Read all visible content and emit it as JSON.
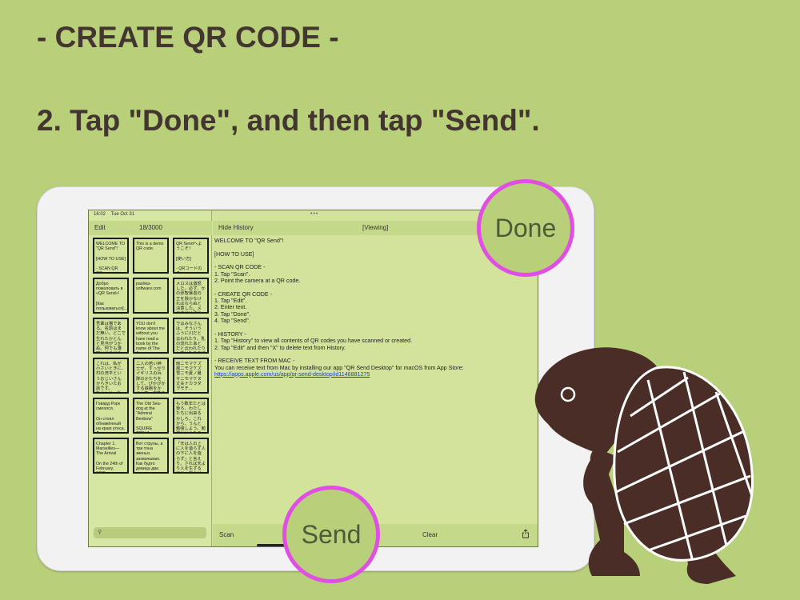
{
  "headings": {
    "title": "- CREATE QR CODE -",
    "instruction": "2. Tap \"Done\", and then tap \"Send\"."
  },
  "status": {
    "time": "16:02",
    "date": "Tue Oct 31"
  },
  "sidebar": {
    "edit_label": "Edit",
    "count": "18/3000",
    "search_placeholder": "",
    "cells": [
      "WELCOME TO \"QR Send\"!\n\n[HOW TO USE]\n\n- SCAN QR CO...",
      "This is a demo QR code.",
      "QR Sendへようこそ！\n\n[使い方]\n\n- QRコードのス...",
      "Добро пожаловать в «QR Send»!\n\n[Как пользоваться]...",
      "pashka-software.com",
      "メロスは激怒した。必ず、かの邪智暴虐の王を除かなければならぬと決意した。メロスには政治がわか...",
      "吾輩は猫である。名前はまだ無い。どこで生れたかとんと見当がつかぬ。何でも薄暗いじめじめした所...",
      "YOU don't know about me without you have read a book by the name of The A...",
      "ではみなさんは、そういうふうに川だと云われたり、乳の流れたあとだと云われたりしていたこのぼんや...",
      "これは、私が小さいときに、村の茂平というおじいさんからきいたお話です。\nむかしは、私た...",
      "二人の若い紳士が、すっかりイギリスの兵隊のかたちをして、ぴかぴかする鉄砲をかついで、白熊のよ...",
      "雨ニモマケズ\n風ニモマケズ\n雪ニモ夏ノ暑サニモマケヌ\n丈夫ナカラダヲモチ...",
      "Говард Рорк смеялся.\n\nОн стоял обнажённый на краю утеса. Д...",
      "The Old Sea-dog at the \"Admiral Benbow\"\n\nSQUIRE TRELA...",
      "もう数年たとは後ろ、わたしたちに出来るかしら。これから、うんと勉強しよう。勉強というもの...",
      "Chapter 1. Marseilles—The Arrival\n\nOn the 24th of February, 1815...",
      "Вот струны, а три тона звенья, захвачьваю. Как будто девица два парня желали. — Од...",
      "「天は人の上に人を造らず人の下に人を造らず」と言えり。されば天より人を生ずるには、万人は万人..."
    ]
  },
  "main": {
    "hide_history_label": "Hide History",
    "viewing_label": "[Viewing]",
    "content_text": "WELCOME TO \"QR Send\"!\n\n[HOW TO USE]\n\n- SCAN QR CODE -\n1. Tap \"Scan\".\n2. Point the camera at a QR code.\n\n- CREATE QR CODE -\n1. Tap \"Edit\".\n2. Enter text.\n3. Tap \"Done\".\n4. Tap \"Send\".\n\n- HISTORY -\n1. Tap \"History\" to view all contents of QR codes you have scanned or created.\n2. Tap \"Edit\" and then \"X\" to delete text from History.\n\n- RECEIVE TEXT FROM MAC -\nYou can receive text from Mac by installing our app \"QR Send Desktop\" for macOS from App Store:",
    "link": "https://apps.apple.com/us/app/qr-send-desktop/id1146881275",
    "scan_label": "Scan",
    "clear_label": "Clear"
  },
  "callouts": {
    "done_label": "Done",
    "send_label": "Send"
  },
  "icons": [
    "search-icon",
    "share-icon",
    "multitask-dots-icon",
    "turtle-mascot"
  ],
  "colors": {
    "background": "#b9d07a",
    "screen": "#d3e39c",
    "callout_ring": "#e04ee4",
    "heading_text": "#43352f",
    "turtle": "#4a2d27"
  }
}
